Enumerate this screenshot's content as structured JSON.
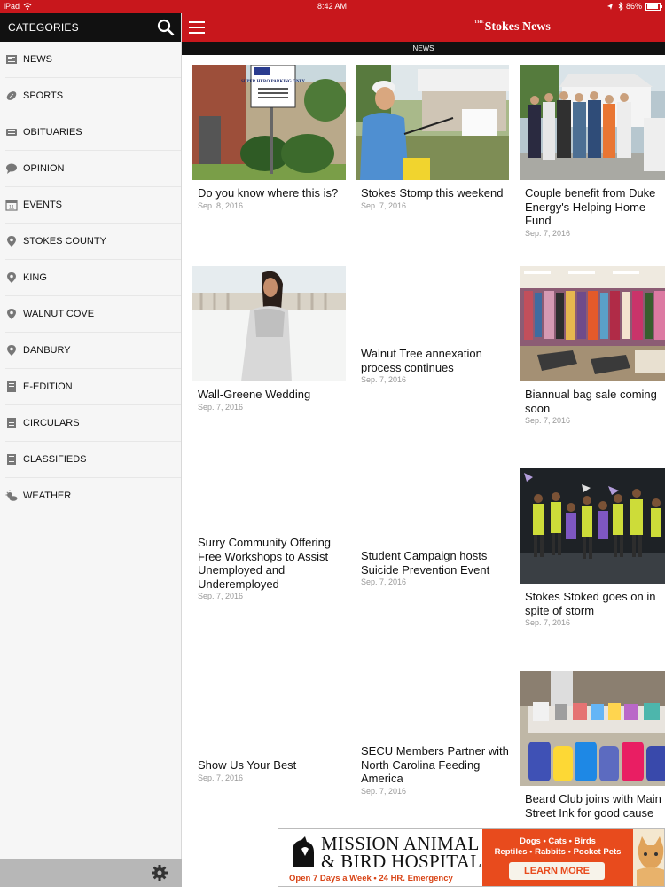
{
  "status_bar": {
    "device": "iPad",
    "time": "8:42 AM",
    "battery": "86%"
  },
  "sidebar": {
    "header_title": "CATEGORIES",
    "items": [
      {
        "label": "NEWS",
        "icon": "newspaper-icon"
      },
      {
        "label": "SPORTS",
        "icon": "football-icon"
      },
      {
        "label": "OBITUARIES",
        "icon": "obituary-icon"
      },
      {
        "label": "OPINION",
        "icon": "speech-bubble-icon"
      },
      {
        "label": "EVENTS",
        "icon": "calendar-icon"
      },
      {
        "label": "STOKES COUNTY",
        "icon": "location-pin-icon"
      },
      {
        "label": "KING",
        "icon": "location-pin-icon"
      },
      {
        "label": "WALNUT COVE",
        "icon": "location-pin-icon"
      },
      {
        "label": "DANBURY",
        "icon": "location-pin-icon"
      },
      {
        "label": "E-EDITION",
        "icon": "document-icon"
      },
      {
        "label": "CIRCULARS",
        "icon": "document-icon"
      },
      {
        "label": "CLASSIFIEDS",
        "icon": "document-icon"
      },
      {
        "label": "WEATHER",
        "icon": "weather-icon"
      }
    ]
  },
  "header": {
    "logo_small": "THE",
    "logo_text": "Stokes News",
    "section": "NEWS"
  },
  "articles": [
    {
      "title": "Do you know where this is?",
      "date": "Sep. 8, 2016",
      "image": "sign-photo",
      "sign_text": "SUPER HERO PARKING ONLY"
    },
    {
      "title": "Stokes Stomp this weekend",
      "date": "Sep. 7, 2016",
      "image": "festival-photo"
    },
    {
      "title": "Couple benefit from Duke Energy's Helping Home Fund",
      "date": "Sep. 7, 2016",
      "image": "group-photo"
    },
    {
      "title": "Wall-Greene Wedding",
      "date": "Sep. 7, 2016",
      "image": "bride-photo"
    },
    {
      "title": "Walnut Tree annexation process continues",
      "date": "Sep. 7, 2016",
      "image": ""
    },
    {
      "title": "Biannual bag sale coming soon",
      "date": "Sep. 7, 2016",
      "image": "clothing-rack-photo"
    },
    {
      "title": "Surry Community Offering Free Workshops to Assist Unemployed and Underemployed",
      "date": "Sep. 7, 2016",
      "image": ""
    },
    {
      "title": "Student Campaign hosts Suicide Prevention Event",
      "date": "Sep. 7, 2016",
      "image": ""
    },
    {
      "title": "Stokes Stoked goes on in spite of storm",
      "date": "Sep. 7, 2016",
      "image": "dancers-photo"
    },
    {
      "title": "Show Us Your Best",
      "date": "Sep. 7, 2016",
      "image": ""
    },
    {
      "title": "SECU Members Partner with North Carolina Feeding America",
      "date": "Sep. 7, 2016",
      "image": ""
    },
    {
      "title": "Beard Club joins with Main Street Ink for good cause",
      "date": "",
      "image": "backpacks-photo"
    }
  ],
  "ad": {
    "line1": "MISSION ANIMAL",
    "line2": "& BIRD HOSPITAL",
    "tagline": "Open 7 Days a Week • 24 HR. Emergency",
    "animals1": "Dogs • Cats • Birds",
    "animals2": "Reptiles • Rabbits • Pocket Pets",
    "cta": "LEARN MORE"
  },
  "colors": {
    "brand_red": "#c8171c",
    "header_black": "#111111",
    "ad_orange": "#e84b1d"
  }
}
